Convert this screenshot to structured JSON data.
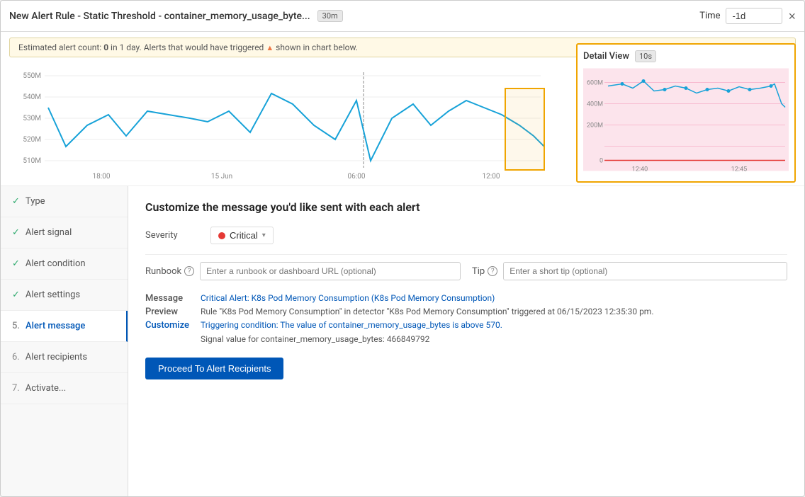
{
  "header": {
    "title": "New Alert Rule - Static Threshold - container_memory_usage_byte...",
    "badge": "30m",
    "time_label": "Time",
    "time_value": "-1d",
    "close_label": "×"
  },
  "alert_banner": {
    "text_before": "Estimated alert count:",
    "count": "0",
    "text_after": "in 1 day. Alerts that would have triggered",
    "text_end": "shown in chart below."
  },
  "chart": {
    "y_labels": [
      "550M",
      "540M",
      "530M",
      "520M",
      "510M"
    ],
    "x_labels": [
      "18:00",
      "15 Jun",
      "06:00",
      "12:00"
    ]
  },
  "detail_view": {
    "title": "Detail View",
    "badge": "10s",
    "x_labels": [
      "12:40",
      "12:45"
    ],
    "y_labels": [
      "600M",
      "400M",
      "200M",
      "0"
    ]
  },
  "sidebar": {
    "items": [
      {
        "id": "type",
        "label": "Type",
        "prefix": "✓",
        "active": false
      },
      {
        "id": "alert-signal",
        "label": "Alert signal",
        "prefix": "✓",
        "active": false
      },
      {
        "id": "alert-condition",
        "label": "Alert condition",
        "prefix": "✓",
        "active": false
      },
      {
        "id": "alert-settings",
        "label": "Alert settings",
        "prefix": "✓",
        "active": false
      },
      {
        "id": "alert-message",
        "label": "Alert message",
        "prefix": "5.",
        "active": true
      },
      {
        "id": "alert-recipients",
        "label": "Alert recipients",
        "prefix": "6.",
        "active": false
      },
      {
        "id": "activate",
        "label": "Activate...",
        "prefix": "7.",
        "active": false
      }
    ]
  },
  "panel": {
    "title": "Customize the message you'd like sent with each alert",
    "severity": {
      "label": "Severity",
      "value": "Critical",
      "chevron": "▾"
    },
    "runbook": {
      "label": "Runbook",
      "placeholder": "Enter a runbook or dashboard URL (optional)"
    },
    "tip": {
      "label": "Tip",
      "placeholder": "Enter a short tip (optional)"
    },
    "message_preview": {
      "label": "Message Preview",
      "customize_label": "Customize",
      "title_text": "Critical Alert: K8s Pod Memory Consumption (K8s Pod Memory Consumption)",
      "body_text": "Rule \"K8s Pod Memory Consumption\" in detector \"K8s Pod Memory Consumption\" triggered at 06/15/2023 12:35:30 pm.",
      "trigger_text": "Triggering condition: The value of container_memory_usage_bytes is above 570.",
      "signal_text": "Signal value for container_memory_usage_bytes: 466849792"
    },
    "proceed_button": "Proceed To Alert Recipients"
  }
}
